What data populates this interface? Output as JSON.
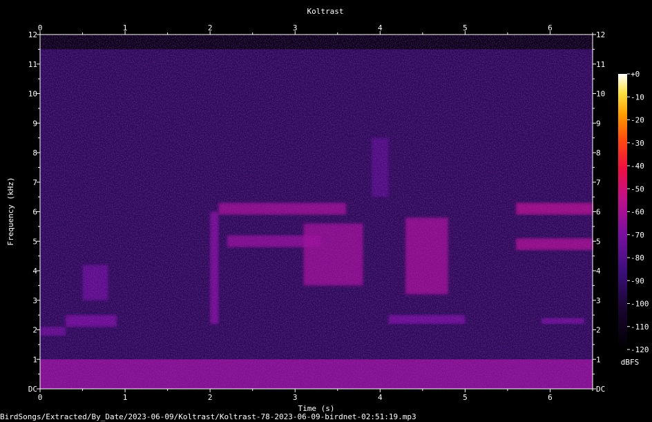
{
  "chart_data": {
    "type": "heatmap",
    "title": "Koltrast",
    "xlabel": "Time (s)",
    "ylabel": "Frequency (kHz)",
    "xlim": [
      0,
      6.5
    ],
    "ylim": [
      0,
      12
    ],
    "x_ticks": [
      0,
      1,
      2,
      3,
      4,
      5,
      6
    ],
    "x_tick_labels": [
      "0",
      "1",
      "2",
      "3",
      "4",
      "5",
      "6"
    ],
    "y_ticks": [
      0,
      1,
      2,
      3,
      4,
      5,
      6,
      7,
      8,
      9,
      10,
      11,
      12
    ],
    "y_tick_labels": [
      "DC",
      "1",
      "2",
      "3",
      "4",
      "5",
      "6",
      "7",
      "8",
      "9",
      "10",
      "11",
      "12"
    ],
    "colorbar": {
      "label": "dBFS",
      "range": [
        -120,
        0
      ],
      "ticks": [
        0,
        -10,
        -20,
        -30,
        -40,
        -50,
        -60,
        -70,
        -80,
        -90,
        -100,
        -110,
        -120
      ],
      "tick_labels": [
        "+0",
        "-10",
        "-20",
        "-30",
        "-40",
        "-50",
        "-60",
        "-70",
        "-80",
        "-90",
        "-100",
        "-110",
        "-120"
      ],
      "colormap": [
        "#000000",
        "#1a0530",
        "#3a0f7a",
        "#7a10a0",
        "#c0108a",
        "#f01040",
        "#ff4a10",
        "#ff9a00",
        "#ffe040",
        "#ffffff"
      ]
    },
    "signal_max_khz": 11.5,
    "background_level_db": -100,
    "low_freq_band": {
      "khz": [
        0,
        1
      ],
      "db": -75
    },
    "events": [
      {
        "t": [
          0.0,
          0.3
        ],
        "f": [
          1.8,
          2.1
        ],
        "db": -82
      },
      {
        "t": [
          0.3,
          0.9
        ],
        "f": [
          2.1,
          2.5
        ],
        "db": -80
      },
      {
        "t": [
          0.5,
          0.8
        ],
        "f": [
          3.0,
          4.2
        ],
        "db": -84
      },
      {
        "t": [
          2.0,
          2.1
        ],
        "f": [
          2.2,
          6.0
        ],
        "db": -78
      },
      {
        "t": [
          2.1,
          3.6
        ],
        "f": [
          5.9,
          6.3
        ],
        "db": -72
      },
      {
        "t": [
          2.2,
          3.3
        ],
        "f": [
          4.8,
          5.2
        ],
        "db": -75
      },
      {
        "t": [
          3.1,
          3.8
        ],
        "f": [
          3.5,
          5.6
        ],
        "db": -73
      },
      {
        "t": [
          3.9,
          4.1
        ],
        "f": [
          6.5,
          8.5
        ],
        "db": -88
      },
      {
        "t": [
          4.3,
          4.8
        ],
        "f": [
          3.2,
          5.8
        ],
        "db": -72
      },
      {
        "t": [
          4.1,
          5.0
        ],
        "f": [
          2.2,
          2.5
        ],
        "db": -80
      },
      {
        "t": [
          5.6,
          6.5
        ],
        "f": [
          5.9,
          6.3
        ],
        "db": -68
      },
      {
        "t": [
          5.6,
          6.5
        ],
        "f": [
          4.7,
          5.1
        ],
        "db": -70
      },
      {
        "t": [
          5.9,
          6.4
        ],
        "f": [
          2.2,
          2.4
        ],
        "db": -80
      }
    ]
  },
  "file_path": "BirdSongs/Extracted/By_Date/2023-06-09/Koltrast/Koltrast-78-2023-06-09-birdnet-02:51:19.mp3"
}
